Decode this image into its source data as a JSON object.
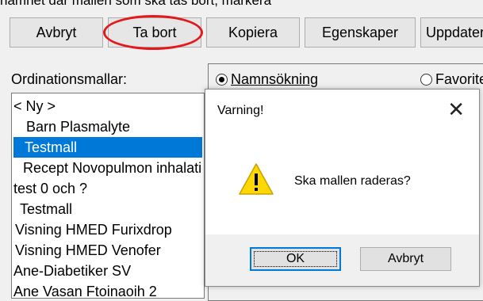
{
  "top_fragment": "namnet där mallen som ska tas bort, markera",
  "toolbar": {
    "cancel": "Avbryt",
    "delete": "Ta bort",
    "copy": "Kopiera",
    "properties": "Egenskaper",
    "update": "Uppdatera"
  },
  "templates_label": "Ordinationsmallar:",
  "templates": [
    {
      "label": "< Ny >",
      "selected": false
    },
    {
      "label": "Barn Plasmalyte",
      "selected": false
    },
    {
      "label": "Testmall",
      "selected": true
    },
    {
      "label": "Recept Novopulmon inhalation",
      "selected": false
    },
    {
      "label": "test 0 och ?",
      "selected": false
    },
    {
      "label": "Testmall",
      "selected": false
    },
    {
      "label": "Visning HMED Furixdrop",
      "selected": false
    },
    {
      "label": "Visning HMED Venofer",
      "selected": false
    },
    {
      "label": "Ane-Diabetiker SV",
      "selected": false
    },
    {
      "label": "Ane Vasan Ftoinaoih 2",
      "selected": false
    }
  ],
  "search": {
    "name_search": "Namnsökning",
    "favorites": "Favoriter"
  },
  "dialog": {
    "title": "Varning!",
    "close_glyph": "✕",
    "icon": "warning-icon",
    "message": "Ska mallen raderas?",
    "ok": "OK",
    "cancel": "Avbryt"
  },
  "colors": {
    "selection": "#0078d7",
    "highlight_circle": "#e3191c",
    "warning_yellow": "#ffd800"
  }
}
